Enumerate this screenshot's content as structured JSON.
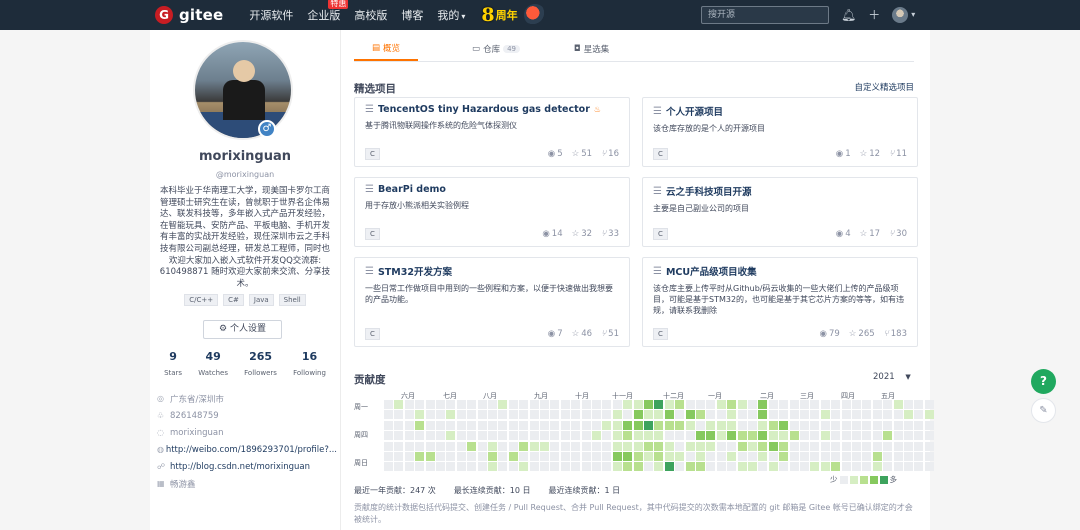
{
  "nav": {
    "logo_mark": "G",
    "logo_text": "gitee",
    "items": [
      {
        "label": "开源软件"
      },
      {
        "label": "企业版",
        "badge": "特惠"
      },
      {
        "label": "高校版"
      },
      {
        "label": "博客"
      },
      {
        "label": "我的"
      }
    ],
    "anniversary_num": "8",
    "anniversary_text": "周年",
    "search_placeholder": "搜开源"
  },
  "profile": {
    "name": "morixinguan",
    "username": "@morixinguan",
    "bio": "本科毕业于华南理工大学，现美国卡罗尔工商管理硕士研究生在读，曾就职于世界名企伟易达、联发科技等，多年嵌入式产品开发经验，在智能玩具、安防产品、平板电脑、手机开发有丰富的实战开发经验，现任深圳市云之手科技有限公司副总经理，研发总工程师，同时也欢迎大家加入嵌入式软件开发QQ交流群: 610498871 随时欢迎大家前来交流、分享技术。",
    "languages": [
      "C/C++",
      "C#",
      "Java",
      "Shell"
    ],
    "settings_label": "个人设置",
    "stats": [
      {
        "num": "9",
        "label": "Stars"
      },
      {
        "num": "49",
        "label": "Watches"
      },
      {
        "num": "265",
        "label": "Followers"
      },
      {
        "num": "16",
        "label": "Following"
      }
    ],
    "location": "广东省/深圳市",
    "qq": "826148759",
    "wechat": "morixinguan",
    "weibo": "http://weibo.com/1896293701/profile?...",
    "blog": "http://blog.csdn.net/morixinguan",
    "org": "畅游鑫"
  },
  "tabs": [
    {
      "label": "概览",
      "active": true
    },
    {
      "label": "仓库",
      "count": "49"
    },
    {
      "label": "星选集"
    }
  ],
  "featured": {
    "title": "精选项目",
    "custom_link": "自定义精选项目",
    "projects": [
      {
        "name": "TencentOS tiny Hazardous gas detector",
        "gvp": true,
        "desc": "基于腾讯物联网操作系统的危险气体探测仪",
        "lang": "C",
        "watch": "5",
        "star": "51",
        "fork": "16"
      },
      {
        "name": "个人开源项目",
        "desc": "该仓库存放的是个人的开源项目",
        "lang": "C",
        "watch": "1",
        "star": "12",
        "fork": "11"
      },
      {
        "name": "BearPi demo",
        "desc": "用于存放小熊派相关实验例程",
        "lang": "C",
        "watch": "14",
        "star": "32",
        "fork": "33"
      },
      {
        "name": "云之手科技项目开源",
        "desc": "主要是自己副业公司的项目",
        "lang": "C",
        "watch": "4",
        "star": "17",
        "fork": "30"
      },
      {
        "name": "STM32开发方案",
        "desc": "一些日常工作做项目中用到的一些例程和方案，以便于快速做出我想要的产品功能。",
        "lang": "C",
        "watch": "7",
        "star": "46",
        "fork": "51"
      },
      {
        "name": "MCU产品级项目收集",
        "desc": "该仓库主要上传平时从Github/码云收集的一些大佬们上传的产品级项目，可能是基于STM32的，也可能是基于其它芯片方案的等等，如有违规，请联系我删除",
        "lang": "C",
        "watch": "79",
        "star": "265",
        "fork": "183"
      }
    ]
  },
  "contribution": {
    "title": "贡献度",
    "year": "2021",
    "months": [
      "六月",
      "七月",
      "八月",
      "九月",
      "十月",
      "十一月",
      "十二月",
      "一月",
      "二月",
      "三月",
      "四月",
      "五月"
    ],
    "days": [
      "周一",
      "周四",
      "周日"
    ],
    "legend_less": "少",
    "legend_more": "多",
    "colors": [
      "#ebedf0",
      "#d6eec3",
      "#b8e08f",
      "#86c95e",
      "#3da35d"
    ],
    "total": "最近一年贡献：247 次",
    "longest": "最长连续贡献：10 日",
    "recent": "最近连续贡献：1 日",
    "note": "贡献度的统计数据包括代码提交、创建任务 / Pull Request、合并 Pull Request，其中代码提交的次数需本地配置的 git 邮箱是 Gitee 帐号已确认绑定的才会被统计。"
  },
  "floating": {
    "help": "?"
  }
}
